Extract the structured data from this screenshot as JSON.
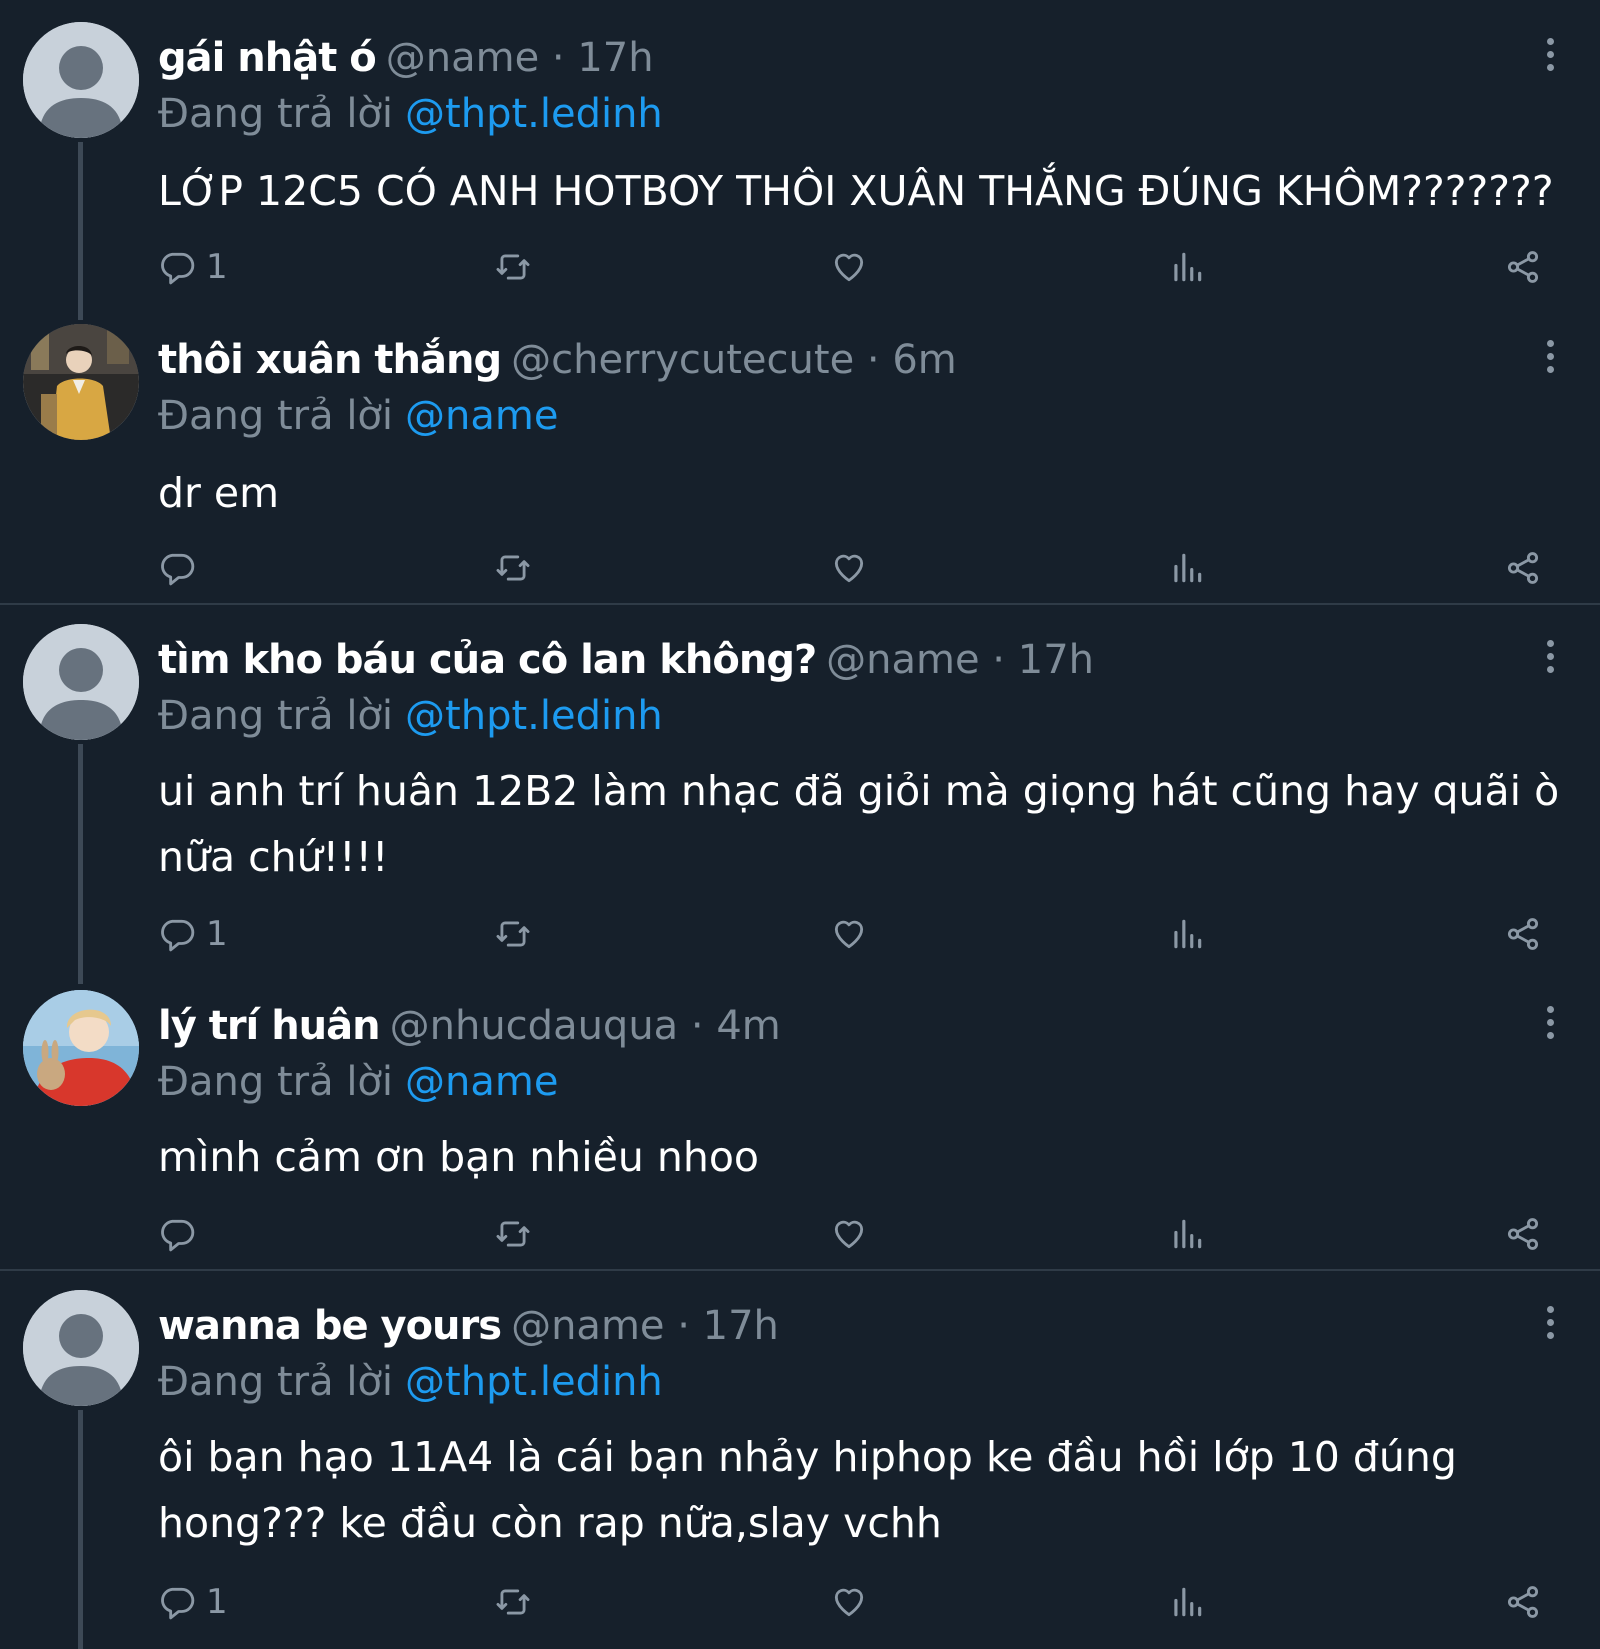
{
  "reply_prefix": "Đang trả lời",
  "tweets": [
    {
      "name": "gái nhật ó",
      "handle_time": "@name · 17h",
      "reply_to": "@thpt.ledinh",
      "text": "LỚP 12C5 CÓ ANH HOTBOY THÔI XUÂN THẮNG ĐÚNG KHÔM???????",
      "reply_count": "1",
      "avatar": "default-avatar"
    },
    {
      "name": "thôi xuân thắng",
      "handle_time": "@cherrycutecute · 6m",
      "reply_to": "@name",
      "text": "dr em",
      "reply_count": "",
      "avatar": "photo-avatar-yellow-jacket"
    },
    {
      "name": "tìm kho báu của cô lan không?",
      "handle_time": "@name · 17h",
      "reply_to": "@thpt.ledinh",
      "text": "ui anh trí huân 12B2 làm nhạc đã giỏi mà giọng hát cũng hay quãi ò nữa chứ!!!!",
      "reply_count": "1",
      "avatar": "default-avatar"
    },
    {
      "name": "lý trí huân",
      "handle_time": "@nhucdauqua · 4m",
      "reply_to": "@name",
      "text": "mình cảm ơn bạn nhiều nhoo",
      "reply_count": "",
      "avatar": "photo-avatar-red-sweater-rabbit"
    },
    {
      "name": "wanna be yours",
      "handle_time": "@name · 17h",
      "reply_to": "@thpt.ledinh",
      "text": "ôi bạn hạo 11A4 là cái bạn nhảy hiphop ke đầu hồi lớp 10 đúng hong??? ke đầu còn rap nữa,slay vchh",
      "reply_count": "1",
      "avatar": "default-avatar"
    }
  ],
  "colors": {
    "background": "#16202b",
    "mention": "#1d9bf0",
    "muted": "#7f8c98",
    "divider": "#2f3b47"
  }
}
